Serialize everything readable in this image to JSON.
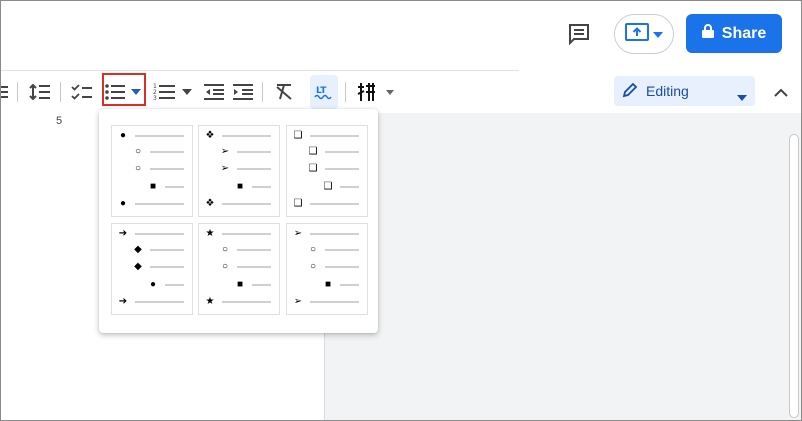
{
  "header": {
    "share_label": "Share",
    "icons": [
      "comment-icon",
      "present-icon",
      "lock-icon"
    ]
  },
  "toolbar": {
    "icons": [
      "line-spacing-icon",
      "checklist-icon",
      "bulleted-list-icon",
      "numbered-list-icon",
      "decrease-indent-icon",
      "increase-indent-icon",
      "clear-formatting-icon",
      "spellcheck-icon",
      "input-tools-icon"
    ],
    "editing_label": "Editing",
    "ruler_number": "5"
  },
  "bullet_presets": [
    {
      "name": "preset-filled-circle",
      "glyphs": [
        "●",
        "○",
        "○",
        "■",
        "●"
      ]
    },
    {
      "name": "preset-diamond-x",
      "glyphs": [
        "❖",
        "➢",
        "➢",
        "■",
        "❖"
      ]
    },
    {
      "name": "preset-3d-box",
      "glyphs": [
        "❑",
        "❑",
        "❑",
        "❑",
        "❑"
      ]
    },
    {
      "name": "preset-arrow",
      "glyphs": [
        "➔",
        "◆",
        "◆",
        "●",
        "➔"
      ]
    },
    {
      "name": "preset-star",
      "glyphs": [
        "★",
        "○",
        "○",
        "■",
        "★"
      ]
    },
    {
      "name": "preset-arrowhead",
      "glyphs": [
        "➢",
        "○",
        "○",
        "■",
        "➢"
      ]
    }
  ],
  "colors": {
    "accent": "#1a73e8",
    "highlight_border": "#d93025",
    "editing_bg": "#e8f0fe"
  }
}
